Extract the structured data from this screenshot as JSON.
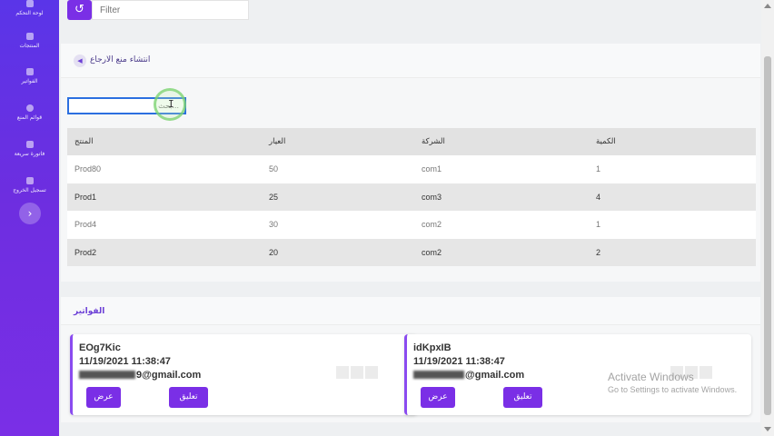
{
  "sidebar": {
    "items": [
      {
        "label": "لوحة التحكم",
        "icon": "dashboard-icon"
      },
      {
        "label": "المنتجات",
        "icon": "box-icon"
      },
      {
        "label": "الفواتير",
        "icon": "invoice-icon"
      },
      {
        "label": "قوائم المنع",
        "icon": "user-icon"
      },
      {
        "label": "فاتورة سريعة",
        "icon": "quick-invoice-icon"
      },
      {
        "label": "تسجيل الخروج",
        "icon": "logout-icon"
      }
    ],
    "toggle_icon": "chevron-right-icon"
  },
  "topbar": {
    "filter_placeholder": "Filter",
    "refresh_icon": "refresh-icon"
  },
  "main": {
    "title": "انتشاء منع الارجاع",
    "search_placeholder": "بحث...",
    "table": {
      "headers": [
        "المنتج",
        "العيار",
        "الشركة",
        "الكمية"
      ],
      "rows": [
        [
          "Prod80",
          "50",
          "com1",
          "1"
        ],
        [
          "Prod1",
          "25",
          "com3",
          "4"
        ],
        [
          "Prod4",
          "30",
          "com2",
          "1"
        ],
        [
          "Prod2",
          "20",
          "com2",
          "2"
        ]
      ]
    }
  },
  "invoices": {
    "title": "الفواتير",
    "cards": [
      {
        "id": "EOg7Kic",
        "date": "11/19/2021 11:38:47",
        "email_suffix": "9@gmail.com",
        "view_label": "عرض",
        "comment_label": "تعليق"
      },
      {
        "id": "idKpxIB",
        "date": "11/19/2021 11:38:47",
        "email_suffix": "@gmail.com",
        "view_label": "عرض",
        "comment_label": "تعليق"
      }
    ]
  },
  "watermark": {
    "line1": "Activate Windows",
    "line2": "Go to Settings to activate Windows."
  },
  "colors": {
    "primary": "#7a2fe6",
    "sidebar_top": "#5a35e8",
    "focus_border": "#2b6fe0"
  }
}
